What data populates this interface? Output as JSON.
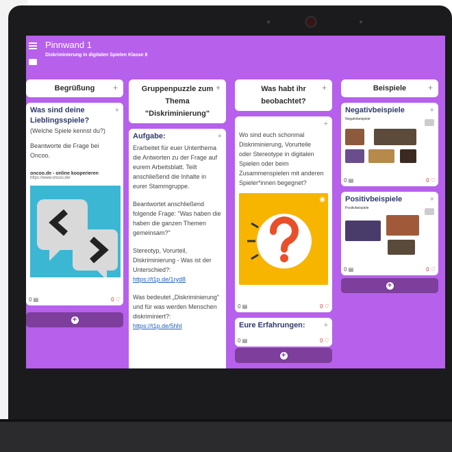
{
  "app": {
    "title": "Pinnwand 1",
    "subtitle": "Diskriminierung in digitalen Spielen Klasse 8"
  },
  "columns": [
    {
      "title": "Begrüßung",
      "cards": [
        {
          "title": "Was sind deine Lieblingsspiele?",
          "lines": [
            "(Welche Spiele kennst du?)",
            "",
            "Beantworte die Frage bei Oncoo."
          ],
          "link_title": "oncoo.de - online kooperieren",
          "link_url": "https://www.oncoo.de/",
          "comments": "0",
          "likes": "0"
        }
      ]
    },
    {
      "title": "Gruppenpuzzle zum Thema \"Diskriminierung\"",
      "cards": [
        {
          "title": "Aufgabe:",
          "p1": "Erarbeitet für euer Unterthema die Antworten zu der Frage auf eurem Arbeitsblatt. Teilt anschließend die Inhalte in eurer Stammgruppe.",
          "p2": "Beantwortet anschließend folgende Frage: \"Was haben die haben die ganzen Themen gemeinsam?\"",
          "p3": "Stereotyp, Vorurteil, Diskriminierung - Was ist der Unterschied?:",
          "link1": "https://t1p.de/1ryd8",
          "p4": "Was bedeutet „Diskriminierung\" und für was werden Menschen diskriminiert?:",
          "link2": "https://t1p.de/5hhl"
        }
      ]
    },
    {
      "title": "Was habt ihr beobachtet?",
      "cards": [
        {
          "text": "Wo sind euch schonmal Diskriminierung, Vorurteile oder Stereotype in digitalen Spielen oder beim Zusammenspielen mit anderen Spieler*innen begegnet?",
          "comments": "0",
          "likes": "0"
        },
        {
          "title": "Eure Erfahrungen:",
          "comments": "0",
          "likes": "0"
        }
      ]
    },
    {
      "title": "Beispiele",
      "cards": [
        {
          "title": "Negativbeispiele",
          "caption": "Negativbeispiele",
          "comments": "0",
          "likes": "0"
        },
        {
          "title": "Positivbeispiele",
          "caption": "Positivbeispiele",
          "comments": "0",
          "likes": "0"
        }
      ]
    }
  ],
  "icons": [
    "menu-icon",
    "plus-icon",
    "comment-icon",
    "heart-icon",
    "eye-icon",
    "add-icon",
    "chevron-left-icon",
    "chevron-right-icon",
    "question-mark-icon",
    "camera-icon"
  ],
  "colors": {
    "board_bg": "#b660ec",
    "add_button": "#7d3e9c",
    "accent_text": "#2f3a6b",
    "question_bg": "#f7b500"
  }
}
